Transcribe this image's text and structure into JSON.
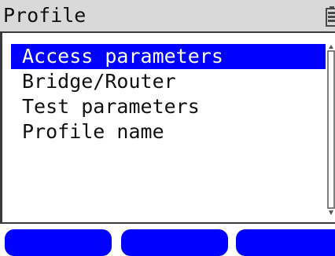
{
  "window": {
    "title": "Profile"
  },
  "status": {
    "battery_icon": "battery-icon"
  },
  "menu": {
    "items": [
      {
        "label": "Access parameters",
        "selected": true
      },
      {
        "label": "Bridge/Router",
        "selected": false
      },
      {
        "label": "Test parameters",
        "selected": false
      },
      {
        "label": "Profile name",
        "selected": false
      }
    ]
  },
  "softkeys": [
    {
      "label": ""
    },
    {
      "label": ""
    },
    {
      "label": ""
    }
  ],
  "colors": {
    "highlight": "#0000ff",
    "title_bar": "#d9d9d9",
    "softkey": "#0000ff"
  }
}
